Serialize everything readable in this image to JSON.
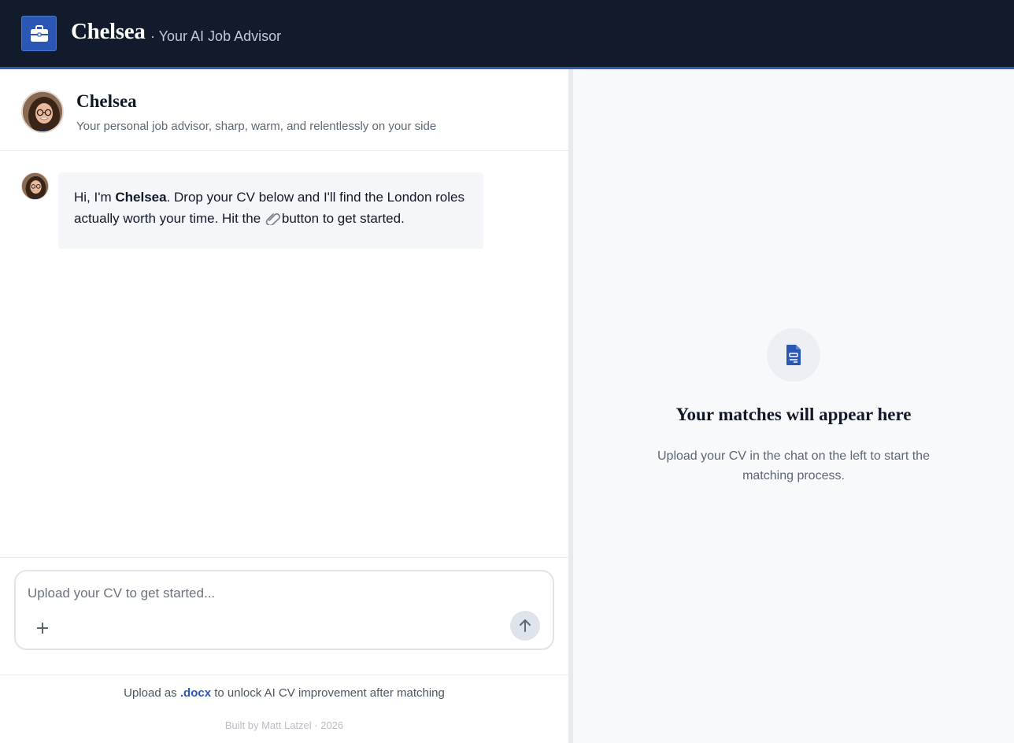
{
  "header": {
    "logo_icon": "briefcase-icon",
    "title": "Chelsea",
    "subtitle": "· Your AI Job Advisor",
    "background": "#111b2c",
    "accent": "#2a56b6"
  },
  "advisor": {
    "name": "Chelsea",
    "description": "Your personal job advisor, sharp, warm, and relentlessly on your side"
  },
  "chat": {
    "messages": [
      {
        "sender": "Chelsea",
        "text_pre": "Hi, I'm ",
        "text_bold": "Chelsea",
        "text_mid": ". Drop your CV below and I'll find the London roles actually worth your time. Hit the ",
        "icon": "paperclip-icon",
        "text_post": "button to get started."
      }
    ]
  },
  "composer": {
    "placeholder": "Upload your CV to get started...",
    "value": "",
    "add_icon": "plus-icon",
    "send_icon": "arrow-up-icon"
  },
  "footer": {
    "hint_pre": "Upload as",
    "hint_highlight": ".docx",
    "hint_post": "to unlock AI CV improvement after matching",
    "credit": "Built by Matt Latzel · 2026"
  },
  "matches": {
    "icon": "document-icon",
    "empty_title": "Your matches will appear here",
    "empty_text": "Upload your CV in the chat on the left to start the matching process."
  }
}
